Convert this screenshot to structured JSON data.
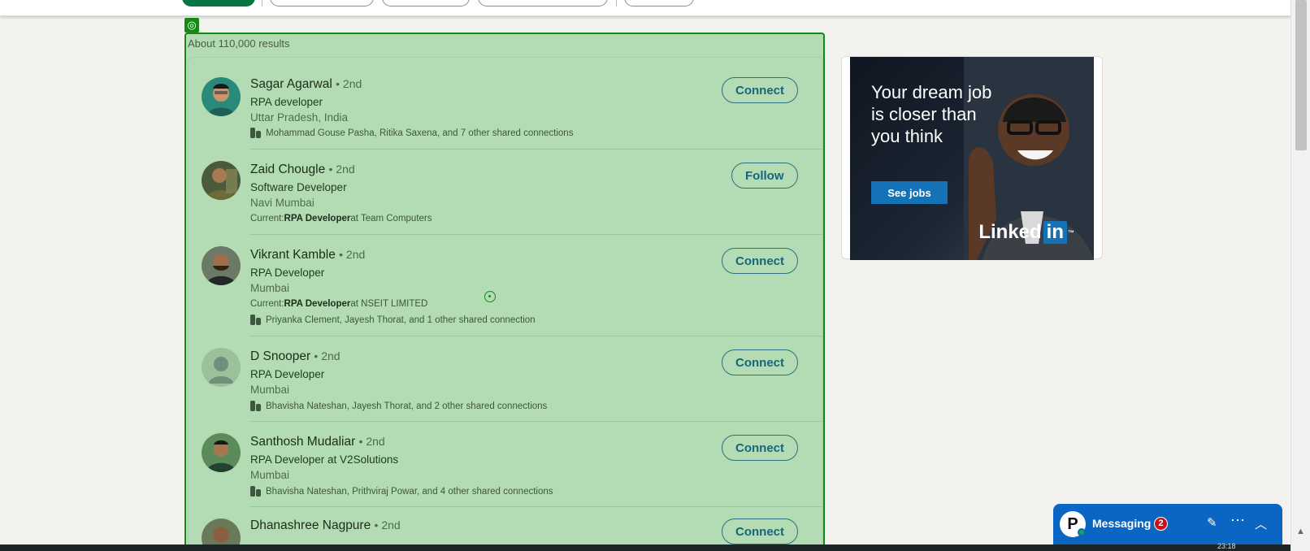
{
  "results_count": "About 110,000 results",
  "people": [
    {
      "name": "Sagar Agarwal",
      "degree": "• 2nd",
      "headline": "RPA developer",
      "location": "Uttar Pradesh, India",
      "meta_text": "Mohammad Gouse Pasha, Ritika Saxena, and 7 other shared connections",
      "action": "Connect"
    },
    {
      "name": "Zaid Chougle",
      "degree": "• 2nd",
      "headline": "Software Developer",
      "location": "Navi Mumbai",
      "current_prefix": "Current: ",
      "current_role": "RPA Developer",
      "current_suffix": " at Team Computers",
      "action": "Follow"
    },
    {
      "name": "Vikrant Kamble",
      "degree": "• 2nd",
      "headline": "RPA Developer",
      "location": "Mumbai",
      "current_prefix": "Current: ",
      "current_role": "RPA Developer",
      "current_suffix": " at NSEIT LIMITED",
      "meta_text": "Priyanka Clement, Jayesh Thorat, and 1 other shared connection",
      "action": "Connect"
    },
    {
      "name": "D Snooper",
      "degree": "• 2nd",
      "headline": "RPA Developer",
      "location": "Mumbai",
      "meta_text": "Bhavisha Nateshan, Jayesh Thorat, and 2 other shared connections",
      "action": "Connect"
    },
    {
      "name": "Santhosh Mudaliar",
      "degree": "• 2nd",
      "headline": "RPA Developer at V2Solutions",
      "location": "Mumbai",
      "meta_text": "Bhavisha Nateshan, Prithviraj Powar, and 4 other shared connections",
      "action": "Connect"
    },
    {
      "name": "Dhanashree Nagpure",
      "degree": "• 2nd",
      "action": "Connect"
    }
  ],
  "ad": {
    "headline": "Your dream job is closer than you think",
    "button": "See jobs",
    "logo_word": "Linked",
    "logo_in": "in",
    "logo_tm": "™"
  },
  "messaging": {
    "label": "Messaging",
    "badge": "2",
    "avatar_letter": "P"
  },
  "clock": "23:18"
}
